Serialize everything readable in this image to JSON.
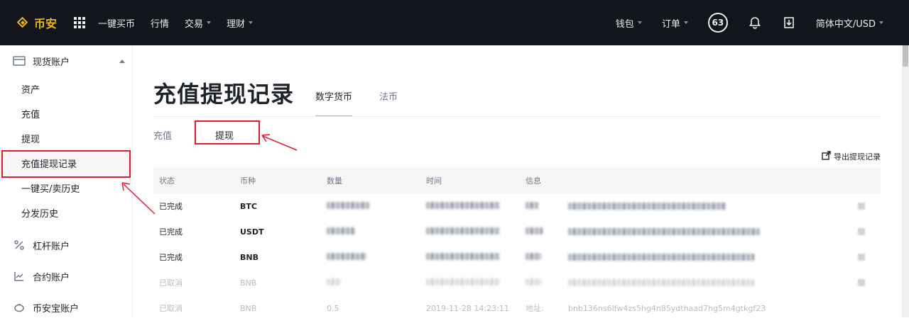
{
  "topbar": {
    "brand": "币安",
    "nav": [
      {
        "label": "一键买币",
        "dropdown": false
      },
      {
        "label": "行情",
        "dropdown": false
      },
      {
        "label": "交易",
        "dropdown": true
      },
      {
        "label": "理财",
        "dropdown": true
      }
    ],
    "wallet": "钱包",
    "orders": "订单",
    "badge": "63",
    "language": "简体中文/USD"
  },
  "sidebar": {
    "spot_account": "现货账户",
    "items": [
      "资产",
      "充值",
      "提现",
      "充值提现记录",
      "一键买/卖历史",
      "分发历史"
    ],
    "active_item": "充值提现记录",
    "sections": [
      "杠杆账户",
      "合约账户",
      "币安宝账户"
    ]
  },
  "main": {
    "title": "充值提现记录",
    "tabs": [
      "数字货币",
      "法币"
    ],
    "active_tab": "数字货币",
    "subtabs": [
      "充值",
      "提现"
    ],
    "active_subtab": "提现",
    "export": "导出提现记录",
    "columns": [
      "状态",
      "币种",
      "数量",
      "时间",
      "信息"
    ],
    "rows": [
      {
        "status": "已完成",
        "coin": "BTC"
      },
      {
        "status": "已完成",
        "coin": "USDT"
      },
      {
        "status": "已完成",
        "coin": "BNB"
      },
      {
        "status": "已取消",
        "coin": "BNB"
      },
      {
        "status": "已取消",
        "coin": "BNB",
        "amount": "0.5",
        "time": "2019-11-28 14:23:11",
        "info_label": "地址:",
        "address": "bnb136ns6lfw4zs5hg4n85ydthaad7hg5m4gtkgf23"
      }
    ]
  },
  "colors": {
    "accent": "#f0b90b",
    "topbar": "#12161c",
    "highlight": "#e8192c"
  }
}
